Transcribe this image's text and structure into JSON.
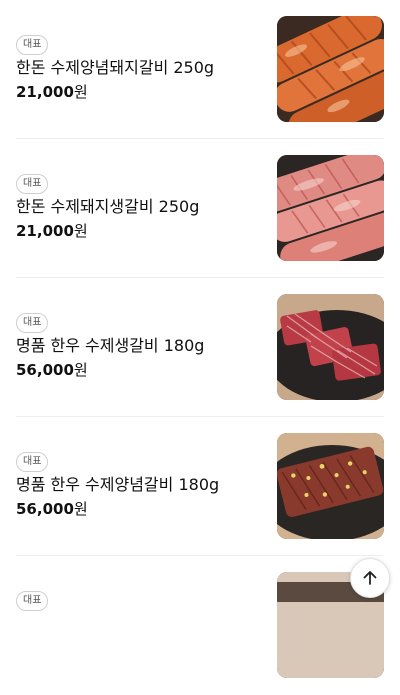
{
  "menu": {
    "items": [
      {
        "badge": "대표",
        "name": "한돈 수제양념돼지갈비 250g",
        "price": "21,000",
        "currency": "원"
      },
      {
        "badge": "대표",
        "name": "한돈 수제돼지생갈비 250g",
        "price": "21,000",
        "currency": "원"
      },
      {
        "badge": "대표",
        "name": "명품 한우 수제생갈비 180g",
        "price": "56,000",
        "currency": "원"
      },
      {
        "badge": "대표",
        "name": "명품 한우 수제양념갈비 180g",
        "price": "56,000",
        "currency": "원"
      },
      {
        "badge": "대표"
      }
    ]
  },
  "scroll_top": {
    "icon": "arrow-up-icon"
  },
  "colors": {
    "badge_border": "#cfcfcf",
    "divider": "#eeeeee",
    "text": "#111111"
  }
}
